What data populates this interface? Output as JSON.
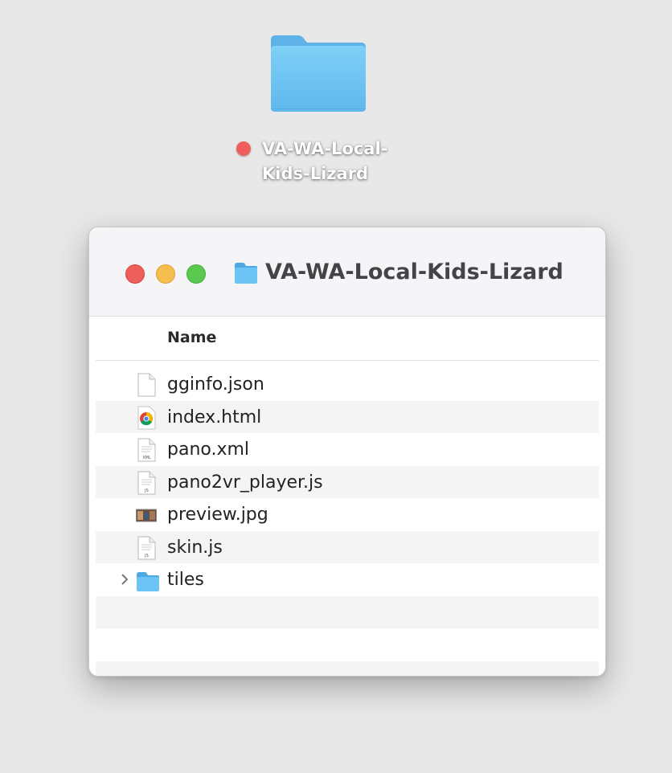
{
  "desktop": {
    "folder_label_line1": "VA-WA-Local-",
    "folder_label_line2": "Kids-Lizard",
    "tag_color": "#ee5f5b"
  },
  "window": {
    "title": "VA-WA-Local-Kids-Lizard",
    "column_header": "Name",
    "files": [
      {
        "name": "gginfo.json",
        "icon": "json-file-icon"
      },
      {
        "name": "index.html",
        "icon": "chrome-html-file-icon"
      },
      {
        "name": "pano.xml",
        "icon": "xml-file-icon"
      },
      {
        "name": "pano2vr_player.js",
        "icon": "js-file-icon"
      },
      {
        "name": "preview.jpg",
        "icon": "image-thumbnail-icon"
      },
      {
        "name": "skin.js",
        "icon": "js-file-icon"
      },
      {
        "name": "tiles",
        "icon": "folder-icon",
        "expandable": true
      }
    ]
  },
  "colors": {
    "close": "#ee5f5b",
    "minimize": "#f6be4f",
    "zoom": "#5bc94f",
    "folder_blue": "#6cc4f4"
  }
}
